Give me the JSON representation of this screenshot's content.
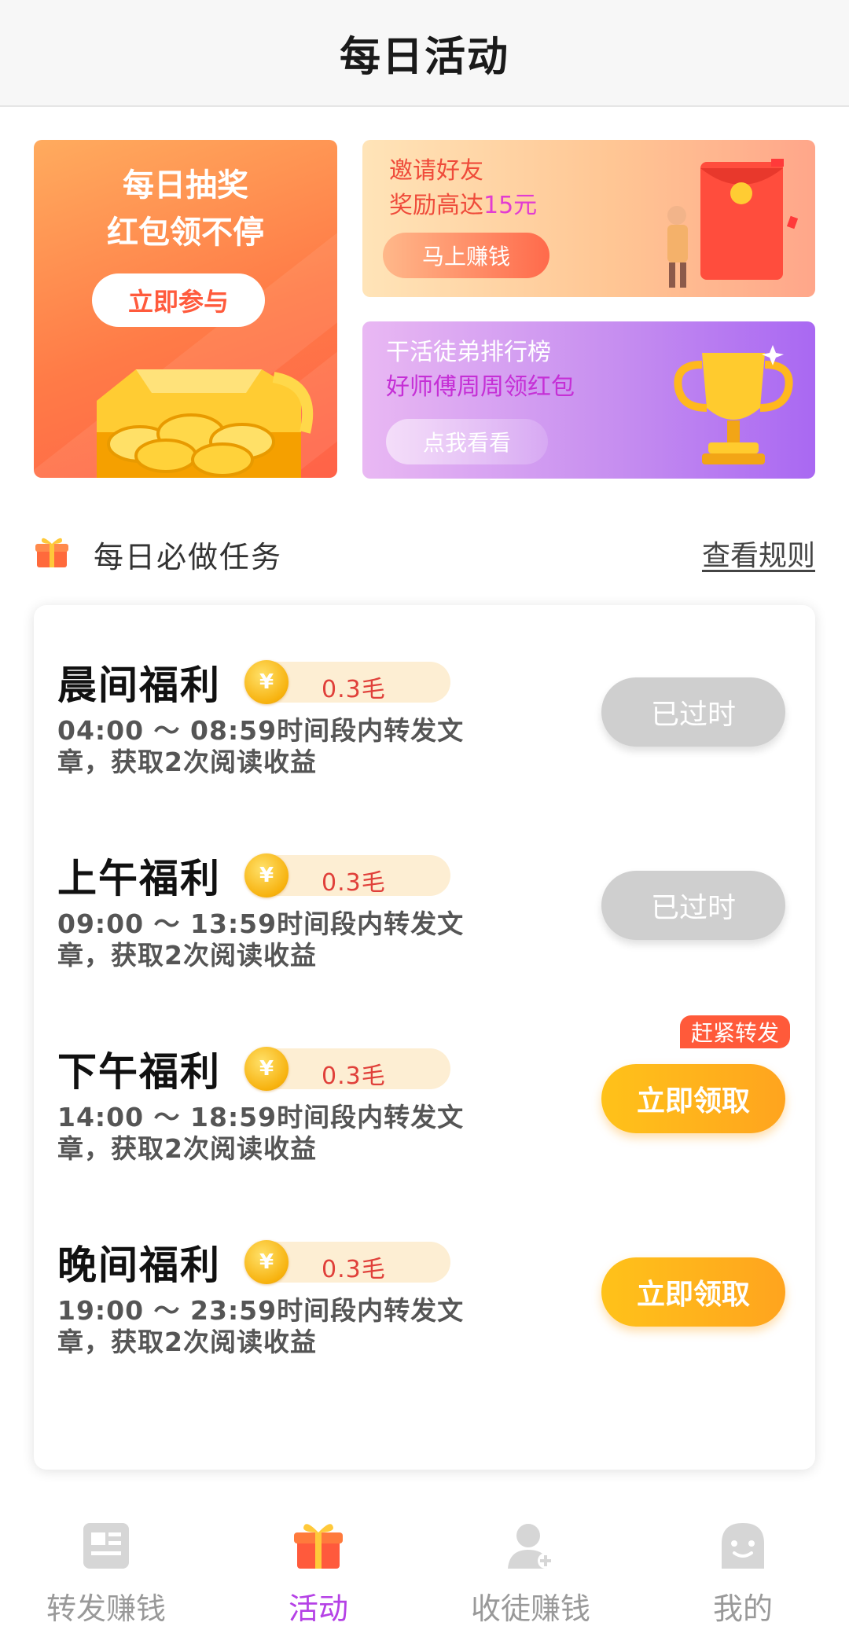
{
  "header": {
    "title": "每日活动"
  },
  "banners": {
    "lottery": {
      "line1": "每日抽奖",
      "line2": "红包领不停",
      "button": "立即参与"
    },
    "invite": {
      "line1": "邀请好友",
      "line2_prefix": "奖励高达",
      "line2_amount": "15元",
      "button": "马上赚钱"
    },
    "ranking": {
      "line1": "干活徒弟排行榜",
      "line2": "好师傅周周领红包",
      "button": "点我看看"
    }
  },
  "section": {
    "title": "每日必做任务",
    "rules_link": "查看规则",
    "icon": "gift-icon"
  },
  "tasks": [
    {
      "title": "晨间福利",
      "coin_symbol": "¥",
      "reward": "0.3毛",
      "desc": "04:00 ～ 08:59时间段内转发文章，获取2次阅读收益",
      "button": "已过时",
      "status": "expired"
    },
    {
      "title": "上午福利",
      "coin_symbol": "¥",
      "reward": "0.3毛",
      "desc": "09:00 ～ 13:59时间段内转发文章，获取2次阅读收益",
      "button": "已过时",
      "status": "expired"
    },
    {
      "title": "下午福利",
      "coin_symbol": "¥",
      "reward": "0.3毛",
      "desc": "14:00 ～ 18:59时间段内转发文章，获取2次阅读收益",
      "button": "立即领取",
      "status": "active",
      "tag": "赶紧转发"
    },
    {
      "title": "晚间福利",
      "coin_symbol": "¥",
      "reward": "0.3毛",
      "desc": "19:00 ～ 23:59时间段内转发文章，获取2次阅读收益",
      "button": "立即领取",
      "status": "active"
    }
  ],
  "nav": [
    {
      "label": "转发赚钱",
      "icon": "newspaper-icon",
      "active": false
    },
    {
      "label": "活动",
      "icon": "gift-icon",
      "active": true
    },
    {
      "label": "收徒赚钱",
      "icon": "add-user-icon",
      "active": false
    },
    {
      "label": "我的",
      "icon": "smile-face-icon",
      "active": false
    }
  ],
  "colors": {
    "active_nav": "#b541e6",
    "accent_orange": "#ffa41e",
    "expired_gray": "#cfcfcf",
    "reward_red": "#e0403a"
  }
}
